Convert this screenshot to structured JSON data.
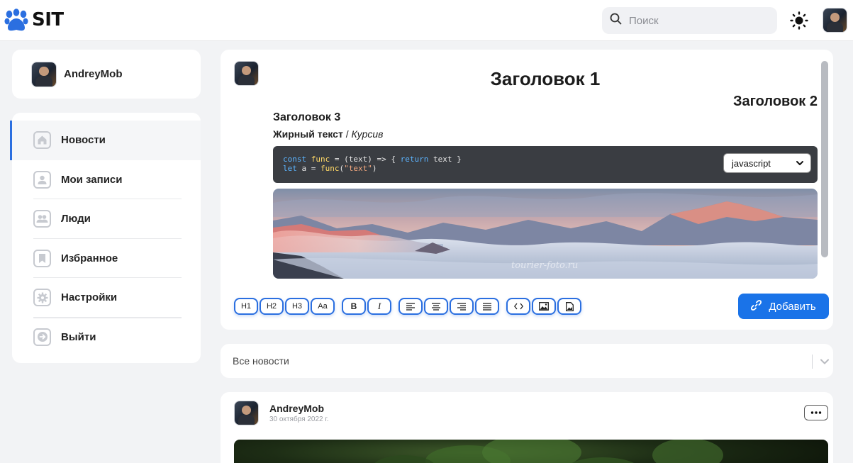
{
  "header": {
    "logo_text": "SIT",
    "logo_icon": "paw-icon",
    "search": {
      "placeholder": "Поиск",
      "value": ""
    },
    "theme_icon": "sun-icon"
  },
  "sidebar": {
    "user": {
      "name": "AndreyMob"
    },
    "items": [
      {
        "label": "Новости",
        "icon": "home-icon",
        "active": true
      },
      {
        "label": "Мои записи",
        "icon": "user-icon",
        "active": false
      },
      {
        "label": "Люди",
        "icon": "people-icon",
        "active": false
      },
      {
        "label": "Избранное",
        "icon": "bookmark-icon",
        "active": false
      },
      {
        "label": "Настройки",
        "icon": "gear-icon",
        "active": false
      },
      {
        "label": "Выйти",
        "icon": "logout-icon",
        "active": false
      }
    ]
  },
  "editor": {
    "heading1": "Заголовок 1",
    "heading2": "Заголовок 2",
    "heading3": "Заголовок 3",
    "bold_text": "Жирный текст",
    "separator": " / ",
    "italic_text": "Курсив",
    "code": {
      "line1": "const func = (text) => { return text }",
      "line2": "let a = func(\"text\")",
      "language": "javascript"
    },
    "image_watermark": "tourier-foto.ru",
    "toolbar": {
      "h1": "H1",
      "h2": "H2",
      "h3": "H3",
      "normal": "Aa",
      "bold": "B",
      "italic": "I"
    },
    "submit_label": "Добавить"
  },
  "filter": {
    "selected": "Все новости"
  },
  "post": {
    "author": "AndreyMob",
    "date": "30 октября 2022 г."
  },
  "colors": {
    "accent": "#1a73e8",
    "background": "#f2f3f5"
  }
}
